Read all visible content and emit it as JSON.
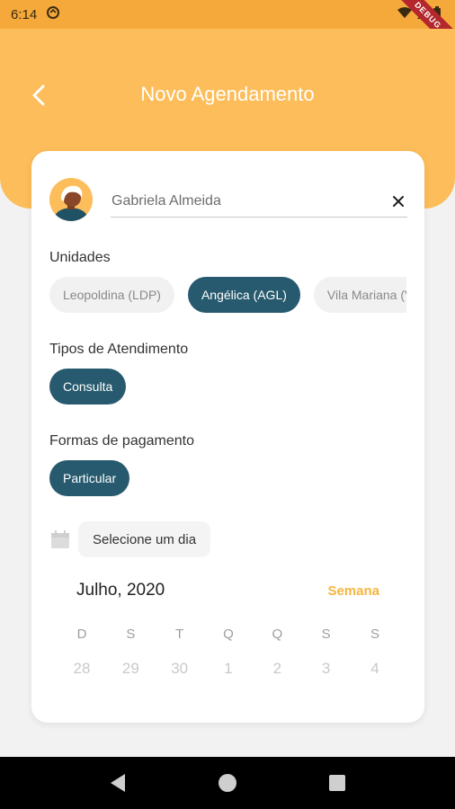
{
  "status_bar": {
    "time": "6:14",
    "debug_label": "DEBUG"
  },
  "header": {
    "title": "Novo Agendamento"
  },
  "patient": {
    "name": "Gabriela Almeida"
  },
  "unidades": {
    "label": "Unidades",
    "options": [
      "Leopoldina (LDP)",
      "Angélica (AGL)",
      "Vila Mariana (VLM)"
    ],
    "selected_index": 1
  },
  "tipos": {
    "label": "Tipos de Atendimento",
    "options": [
      "Consulta"
    ]
  },
  "pagamento": {
    "label": "Formas de pagamento",
    "options": [
      "Particular"
    ]
  },
  "date_picker": {
    "button_label": "Selecione um dia"
  },
  "calendar": {
    "month_label": "Julho, 2020",
    "toggle_label": "Semana",
    "weekdays": [
      "D",
      "S",
      "T",
      "Q",
      "Q",
      "S",
      "S"
    ],
    "days": [
      "28",
      "29",
      "30",
      "1",
      "2",
      "3",
      "4"
    ]
  },
  "colors": {
    "primary": "#275a6e",
    "accent": "#fcbd5a",
    "toggle": "#f5b540"
  }
}
